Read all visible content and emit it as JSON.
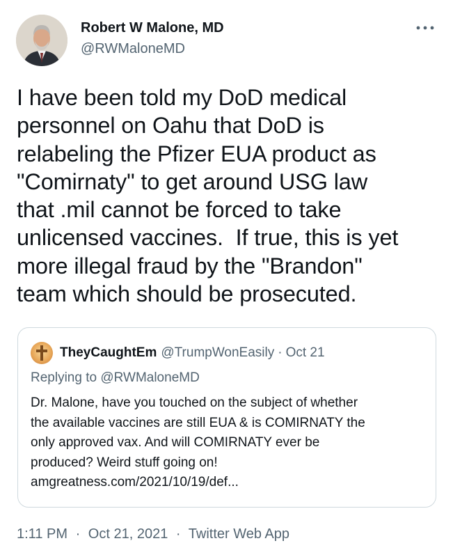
{
  "author": {
    "display_name": "Robert W Malone, MD",
    "handle": "@RWMaloneMD"
  },
  "tweet": {
    "text": "I have been told my DoD medical\npersonnel on Oahu that DoD is\nrelabeling the Pfizer EUA product as\n\"Comirnaty\" to get around USG law\nthat .mil cannot be forced to take\nunlicensed vaccines.  If true, this is yet\nmore illegal fraud by the \"Brandon\"\nteam which should be prosecuted."
  },
  "quote": {
    "display_name": "TheyCaughtEm",
    "handle": "@TrumpWonEasily",
    "separator": "·",
    "date": "Oct 21",
    "replying_prefix": "Replying to",
    "replying_to": "@RWMaloneMD",
    "text": "Dr. Malone, have you touched on the subject of whether\nthe available vaccines are still EUA & is COMIRNATY the\nonly approved vax. And will COMIRNATY ever be\nproduced? Weird stuff going on!\namgreatness.com/2021/10/19/def..."
  },
  "footer": {
    "time": "1:11 PM",
    "separator": "·",
    "date": "Oct 21, 2021",
    "source": "Twitter Web App"
  },
  "icons": {
    "more": "more-horizontal-icon",
    "quote_avatar_glyph": "cross-icon"
  },
  "colors": {
    "text_primary": "#0f1419",
    "text_secondary": "#536471",
    "border": "#cfd9de"
  }
}
